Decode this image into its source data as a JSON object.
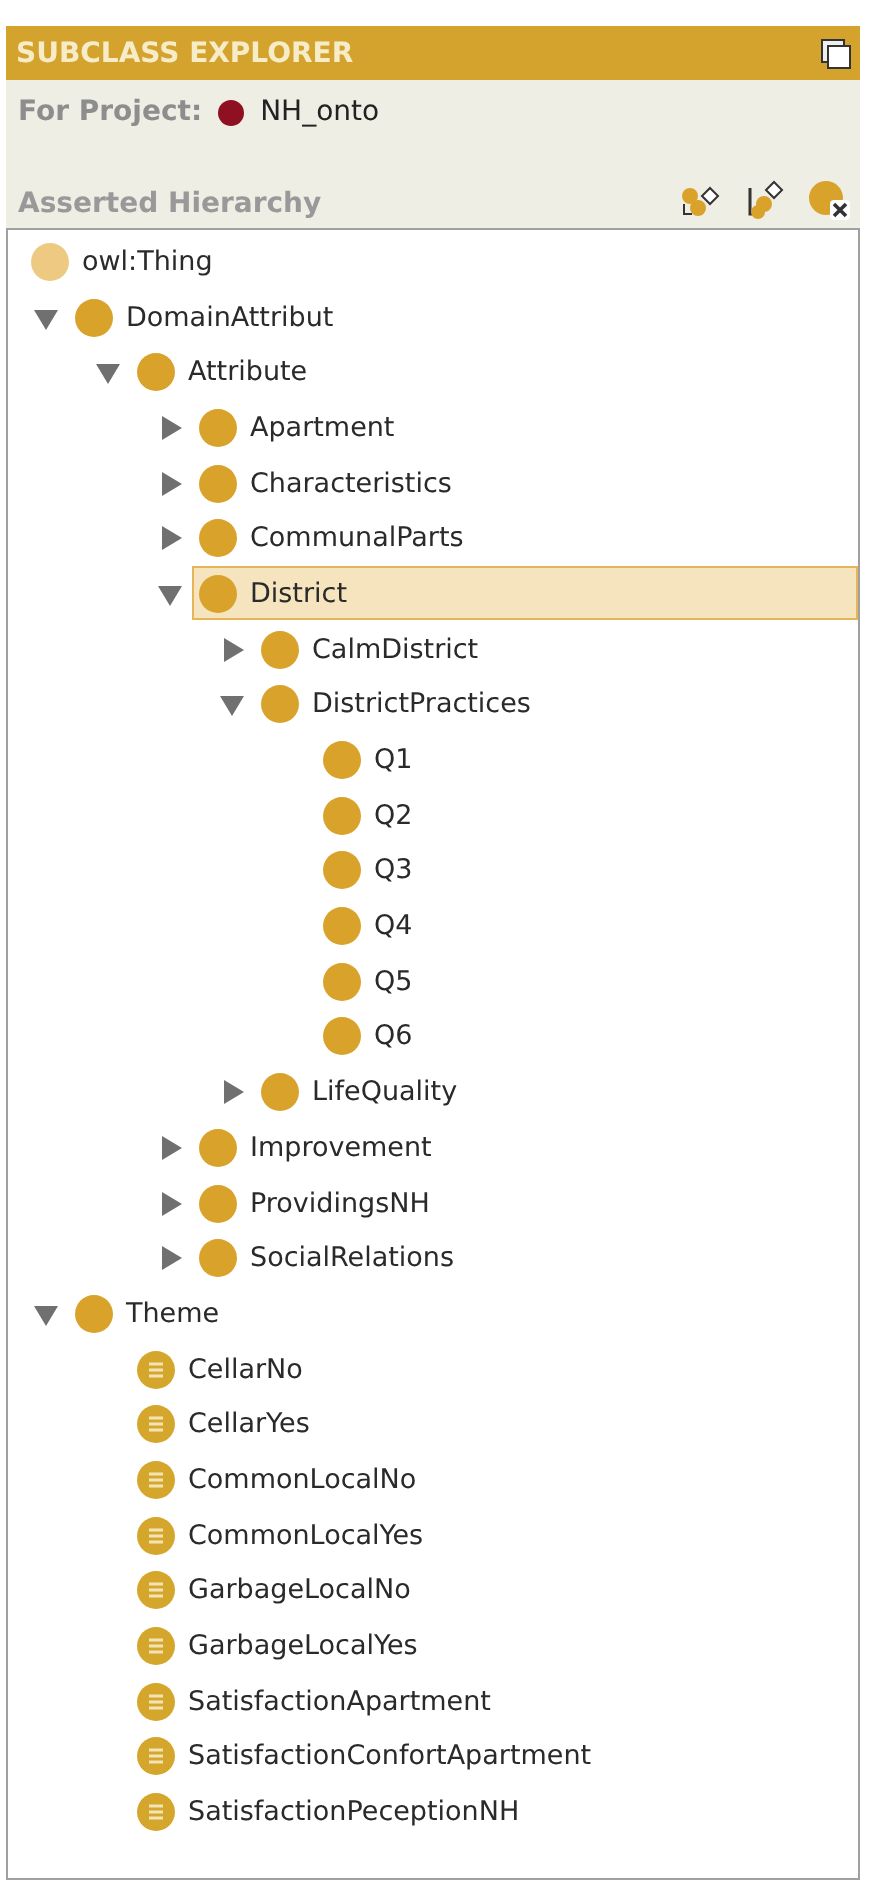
{
  "panel": {
    "title": "SUBCLASS EXPLORER",
    "project_label": "For Project:",
    "project_name": "NH_onto",
    "hierarchy_label": "Asserted Hierarchy"
  },
  "tree": {
    "label": "owl:Thing",
    "kind": "root",
    "selected": false,
    "children": [
      {
        "label": "DomainAttribut",
        "kind": "class",
        "selected": false,
        "expanded": true,
        "children": [
          {
            "label": "Attribute",
            "kind": "class",
            "selected": false,
            "expanded": true,
            "children": [
              {
                "label": "Apartment",
                "kind": "class",
                "selected": false,
                "expanded": false
              },
              {
                "label": "Characteristics",
                "kind": "class",
                "selected": false,
                "expanded": false
              },
              {
                "label": "CommunalParts",
                "kind": "class",
                "selected": false,
                "expanded": false
              },
              {
                "label": "District",
                "kind": "class",
                "selected": true,
                "expanded": true,
                "children": [
                  {
                    "label": "CalmDistrict",
                    "kind": "class",
                    "selected": false,
                    "expanded": false
                  },
                  {
                    "label": "DistrictPractices",
                    "kind": "class",
                    "selected": false,
                    "expanded": true,
                    "children": [
                      {
                        "label": "Q1",
                        "kind": "class",
                        "selected": false
                      },
                      {
                        "label": "Q2",
                        "kind": "class",
                        "selected": false
                      },
                      {
                        "label": "Q3",
                        "kind": "class",
                        "selected": false
                      },
                      {
                        "label": "Q4",
                        "kind": "class",
                        "selected": false
                      },
                      {
                        "label": "Q5",
                        "kind": "class",
                        "selected": false
                      },
                      {
                        "label": "Q6",
                        "kind": "class",
                        "selected": false
                      }
                    ]
                  },
                  {
                    "label": "LifeQuality",
                    "kind": "class",
                    "selected": false,
                    "expanded": false
                  }
                ]
              },
              {
                "label": "Improvement",
                "kind": "class",
                "selected": false,
                "expanded": false
              },
              {
                "label": "ProvidingsNH",
                "kind": "class",
                "selected": false,
                "expanded": false
              },
              {
                "label": "SocialRelations",
                "kind": "class",
                "selected": false,
                "expanded": false
              }
            ]
          }
        ]
      },
      {
        "label": "Theme",
        "kind": "class",
        "selected": false,
        "expanded": true,
        "children": [
          {
            "label": "CellarNo",
            "kind": "individual",
            "selected": false
          },
          {
            "label": "CellarYes",
            "kind": "individual",
            "selected": false
          },
          {
            "label": "CommonLocalNo",
            "kind": "individual",
            "selected": false
          },
          {
            "label": "CommonLocalYes",
            "kind": "individual",
            "selected": false
          },
          {
            "label": "GarbageLocalNo",
            "kind": "individual",
            "selected": false
          },
          {
            "label": "GarbageLocalYes",
            "kind": "individual",
            "selected": false
          },
          {
            "label": "SatisfactionApartment",
            "kind": "individual",
            "selected": false
          },
          {
            "label": "SatisfactionConfortApartment",
            "kind": "individual",
            "selected": false
          },
          {
            "label": "SatisfactionPeceptionNH",
            "kind": "individual",
            "selected": false
          }
        ]
      }
    ]
  }
}
